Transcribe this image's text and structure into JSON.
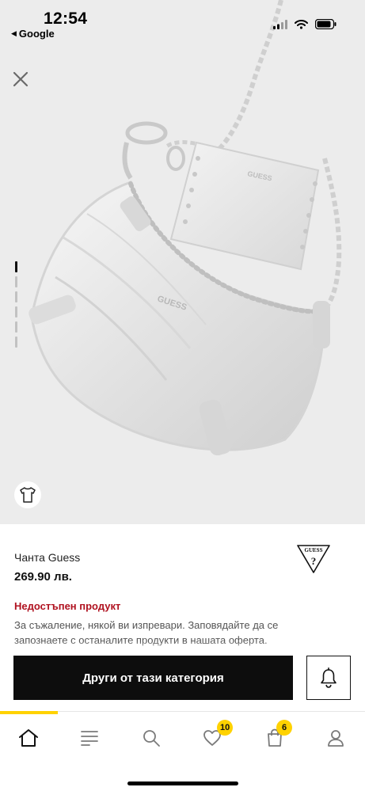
{
  "status_bar": {
    "time": "12:54",
    "back_app": "Google",
    "icons": [
      "signal-icon",
      "wifi-icon",
      "battery-icon"
    ]
  },
  "gallery": {
    "image_description_icon": "bag-product-image",
    "image_logo_text": "GUESS",
    "pager_count": 6,
    "pager_active_index": 0,
    "close_icon": "close-icon",
    "size_guide_icon": "tshirt-icon"
  },
  "product": {
    "name": "Чанта Guess",
    "price": "269.90 лв.",
    "brand_logo_text": "GUESS",
    "brand_logo_mark": "?",
    "unavailable_title": "Недостъпен продукт",
    "unavailable_text": "За съжаление, някой ви изпревари. Заповядайте да се запознаете с останалите продукти в нашата оферта."
  },
  "actions": {
    "category_button_label": "Други от тази категория",
    "notify_icon": "bell-icon"
  },
  "tab_bar": {
    "tabs": [
      {
        "id": "home",
        "icon": "home-icon",
        "active": true
      },
      {
        "id": "categories",
        "icon": "menu-icon"
      },
      {
        "id": "search",
        "icon": "search-icon"
      },
      {
        "id": "favorites",
        "icon": "heart-icon",
        "badge": "10"
      },
      {
        "id": "cart",
        "icon": "bag-icon",
        "badge": "6"
      },
      {
        "id": "account",
        "icon": "user-icon"
      }
    ]
  },
  "colors": {
    "accent": "#ffd200",
    "unavailable": "#b01220",
    "cta": "#0d0d0d",
    "gallery_bg": "#ececec"
  }
}
